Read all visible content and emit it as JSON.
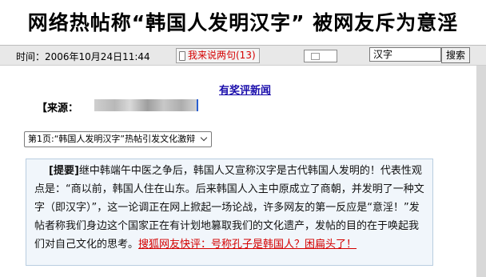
{
  "headline": "网络热帖称“韩国人发明汉字” 被网友斥为意淫",
  "toolbar": {
    "time_text": "时间：2006年10月24日11:44",
    "comment_link": "我来说两句(13)",
    "search_value": "汉字",
    "search_button": "搜索"
  },
  "award_link": "有奖评新闻",
  "source_label": "【来源：",
  "page_select": {
    "selected": "第1页:“韩国人发明汉字”热帖引发文化激辩"
  },
  "summary": {
    "label": "[提要]",
    "text": "继中韩端午中医之争后，韩国人又宣称汉字是古代韩国人发明的！代表性观点是：“商以前，韩国人住在山东。后来韩国人入主中原成立了商朝，并发明了一种文字（即汉字）”，这一论调正在网上掀起一场论战，许多网友的第一反应是“意淫！”发帖者称我们身边这个国家正在有计划地篡取我们的文化遗产，发帖的目的在于唤起我们对自己文化的思考。",
    "link": "搜狐网友快评：号称孔子是韩国人？困扁头了！"
  },
  "icons": {
    "comment": "pen-icon",
    "mini_box": "document-icon",
    "select": "chevron-down-icon"
  }
}
